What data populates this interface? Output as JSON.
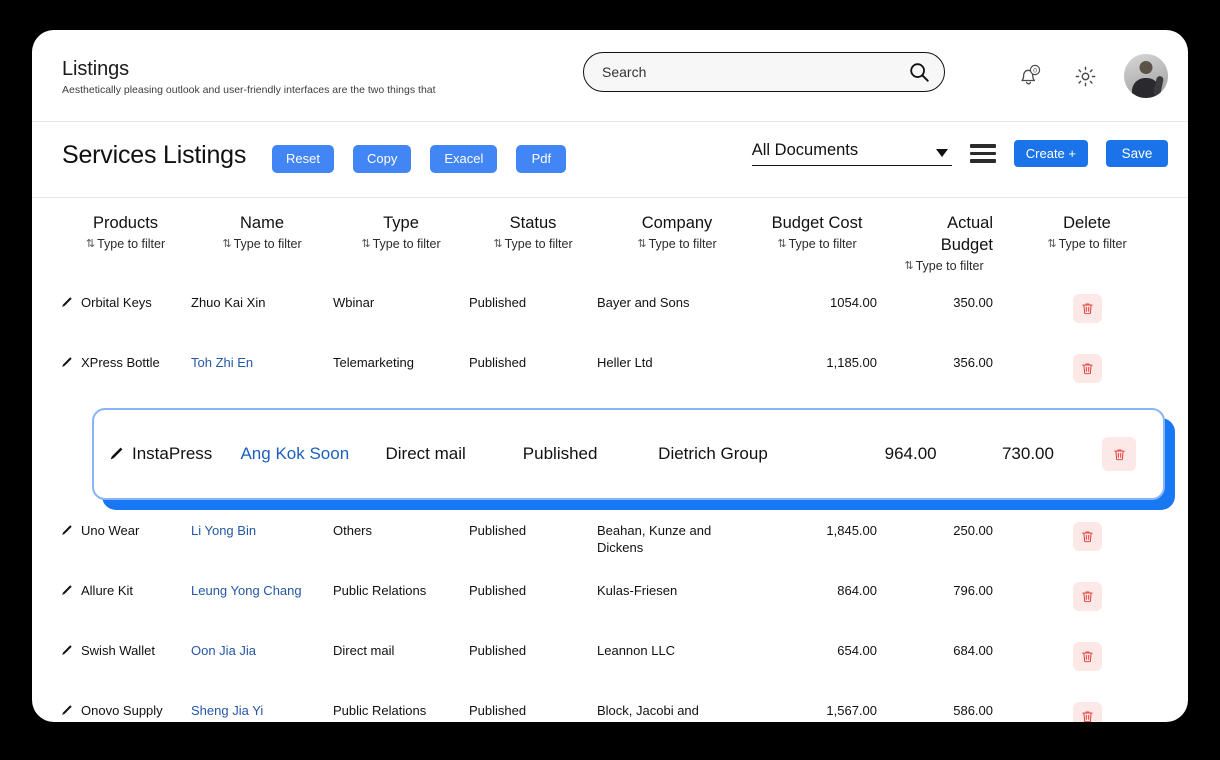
{
  "header": {
    "title": "Listings",
    "subtitle": "Aesthetically pleasing outlook and user-friendly interfaces are the two things that",
    "search_placeholder": "Search",
    "search_value": "",
    "notification_badge": "0"
  },
  "toolbar": {
    "page_title": "Services Listings",
    "reset_label": "Reset",
    "copy_label": "Copy",
    "excel_label": "Exacel",
    "pdf_label": "Pdf",
    "document_filter": "All Documents",
    "create_label": "Create +",
    "save_label": "Save"
  },
  "table": {
    "filter_placeholder": "Type to filter",
    "sort_glyph": "⇅",
    "columns": [
      {
        "key": "products",
        "label": "Products"
      },
      {
        "key": "name",
        "label": "Name"
      },
      {
        "key": "type",
        "label": "Type"
      },
      {
        "key": "status",
        "label": "Status"
      },
      {
        "key": "company",
        "label": "Company"
      },
      {
        "key": "budget_cost",
        "label": "Budget Cost"
      },
      {
        "key": "actual_budget",
        "label": "Actual Budget"
      },
      {
        "key": "delete",
        "label": "Delete"
      }
    ],
    "rows": [
      {
        "products": "Orbital Keys",
        "name": "Zhuo Kai Xin",
        "name_is_link": false,
        "type": "Wbinar",
        "status": "Published",
        "company": "Bayer and Sons",
        "budget_cost": "1054.00",
        "actual_budget": "350.00",
        "highlighted": false
      },
      {
        "products": "XPress Bottle",
        "name": "Toh Zhi En",
        "name_is_link": true,
        "type": "Telemarketing",
        "status": "Published",
        "company": "Heller Ltd",
        "budget_cost": "1,185.00",
        "actual_budget": "356.00",
        "highlighted": false
      },
      {
        "products": "InstaPress",
        "name": "Ang Kok Soon",
        "name_is_link": true,
        "type": "Direct mail",
        "status": "Published",
        "company": "Dietrich Group",
        "budget_cost": "964.00",
        "actual_budget": "730.00",
        "highlighted": true
      },
      {
        "products": "Uno Wear",
        "name": "Li Yong Bin",
        "name_is_link": true,
        "type": "Others",
        "status": "Published",
        "company": "Beahan, Kunze and Dickens",
        "budget_cost": "1,845.00",
        "actual_budget": "250.00",
        "highlighted": false
      },
      {
        "products": "Allure Kit",
        "name": "Leung Yong Chang",
        "name_is_link": true,
        "type": "Public Relations",
        "status": "Published",
        "company": "Kulas-Friesen",
        "budget_cost": "864.00",
        "actual_budget": "796.00",
        "highlighted": false
      },
      {
        "products": "Swish Wallet",
        "name": "Oon Jia Jia",
        "name_is_link": true,
        "type": "Direct mail",
        "status": "Published",
        "company": "Leannon LLC",
        "budget_cost": "654.00",
        "actual_budget": "684.00",
        "highlighted": false
      },
      {
        "products": "Onovo Supply",
        "name": "Sheng Jia Yi",
        "name_is_link": true,
        "type": "Public Relations",
        "status": "Published",
        "company": "Block, Jacobi and Hodkiewicz",
        "budget_cost": "1,567.00",
        "actual_budget": "586.00",
        "highlighted": false
      }
    ]
  },
  "colors": {
    "accent_blue": "#4285f4",
    "action_blue": "#1a73e8",
    "highlight_blue": "#1877f2",
    "link_blue": "#2457a6",
    "delete_red": "#e53935",
    "delete_bg": "#fde8e8"
  }
}
